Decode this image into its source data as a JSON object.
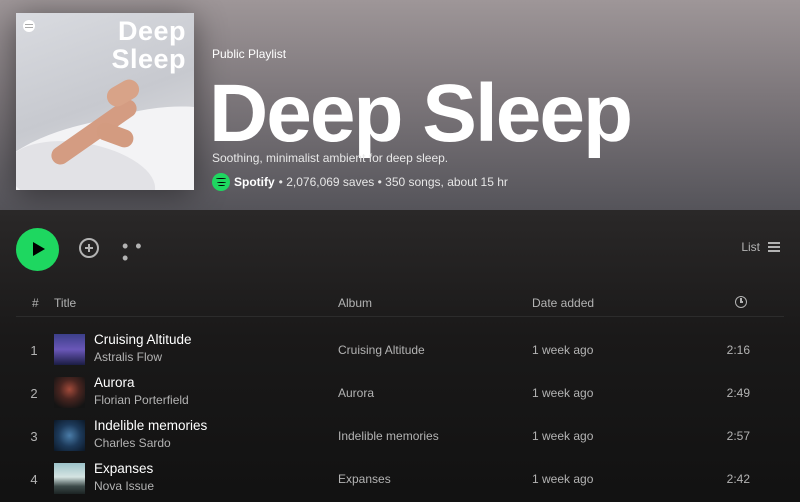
{
  "header": {
    "cover_title_line1": "Deep",
    "cover_title_line2": "Sleep",
    "type_label": "Public Playlist",
    "title": "Deep Sleep",
    "description": "Soothing, minimalist ambient for deep sleep.",
    "owner": "Spotify",
    "stats": "• 2,076,069 saves • 350 songs, about 15 hr"
  },
  "actions": {
    "more_label": "• • •",
    "view_label": "List"
  },
  "table": {
    "headers": {
      "num": "#",
      "title": "Title",
      "album": "Album",
      "date": "Date added"
    },
    "rows": [
      {
        "num": "1",
        "title": "Cruising Altitude",
        "artist": "Astralis Flow",
        "album": "Cruising Altitude",
        "date": "1 week ago",
        "duration": "2:16"
      },
      {
        "num": "2",
        "title": "Aurora",
        "artist": "Florian Porterfield",
        "album": "Aurora",
        "date": "1 week ago",
        "duration": "2:49"
      },
      {
        "num": "3",
        "title": "Indelible memories",
        "artist": "Charles Sardo",
        "album": "Indelible memories",
        "date": "1 week ago",
        "duration": "2:57"
      },
      {
        "num": "4",
        "title": "Expanses",
        "artist": "Nova Issue",
        "album": "Expanses",
        "date": "1 week ago",
        "duration": "2:42"
      }
    ]
  },
  "colors": {
    "accent": "#1ed760",
    "background": "#121212",
    "header_top": "#9e9698"
  }
}
